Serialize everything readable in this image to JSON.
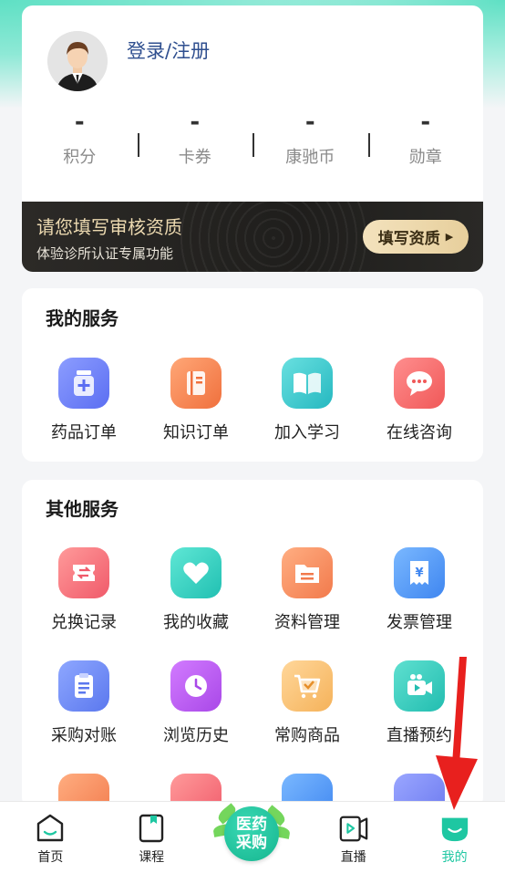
{
  "profile": {
    "login_label": "登录/注册",
    "stats": [
      {
        "value": "-",
        "label": "积分"
      },
      {
        "value": "-",
        "label": "卡券"
      },
      {
        "value": "-",
        "label": "康驰币"
      },
      {
        "value": "-",
        "label": "勋章"
      }
    ]
  },
  "qualification": {
    "title": "请您填写审核资质",
    "subtitle": "体验诊所认证专属功能",
    "button_label": "填写资质"
  },
  "my_services": {
    "title": "我的服务",
    "items": [
      {
        "label": "药品订单",
        "icon": "medicine-bottle-icon"
      },
      {
        "label": "知识订单",
        "icon": "book-icon"
      },
      {
        "label": "加入学习",
        "icon": "open-book-icon"
      },
      {
        "label": "在线咨询",
        "icon": "chat-bubble-icon"
      }
    ]
  },
  "other_services": {
    "title": "其他服务",
    "items": [
      {
        "label": "兑换记录",
        "icon": "ticket-exchange-icon"
      },
      {
        "label": "我的收藏",
        "icon": "heart-icon"
      },
      {
        "label": "资料管理",
        "icon": "folder-icon"
      },
      {
        "label": "发票管理",
        "icon": "invoice-yen-icon"
      },
      {
        "label": "采购对账",
        "icon": "clipboard-icon"
      },
      {
        "label": "浏览历史",
        "icon": "clock-icon"
      },
      {
        "label": "常购商品",
        "icon": "cart-icon"
      },
      {
        "label": "直播预约",
        "icon": "video-camera-icon"
      }
    ]
  },
  "tabbar": {
    "items": [
      {
        "label": "首页",
        "icon": "home-icon"
      },
      {
        "label": "课程",
        "icon": "course-icon"
      },
      {
        "label": "直播",
        "icon": "live-icon"
      },
      {
        "label": "我的",
        "icon": "profile-icon"
      }
    ],
    "center": {
      "line1": "医药",
      "line2": "采购"
    }
  },
  "colors": {
    "accent": "#1ec7a2",
    "title_blue": "#2f4f8f",
    "gold": "#ecd9b0",
    "arrow_red": "#e8201e"
  }
}
